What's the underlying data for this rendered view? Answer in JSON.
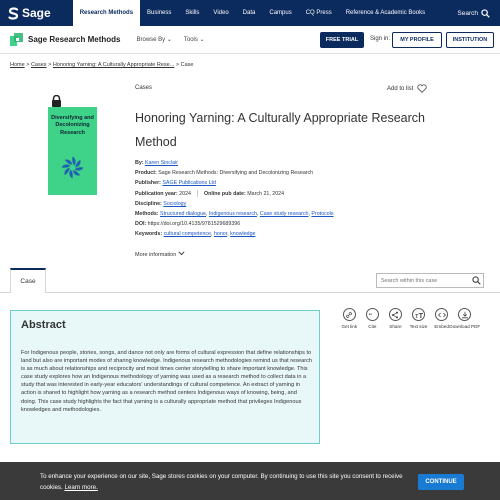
{
  "topbar": {
    "brand": "Sage",
    "nav": [
      "Research Methods",
      "Business",
      "Skills",
      "Video",
      "Data",
      "Campus",
      "CQ Press",
      "Reference & Academic Books"
    ],
    "active_nav": "Research Methods",
    "search_label": "Search",
    "bg_color": "#0b2a5e"
  },
  "secbar": {
    "product_name": "Sage Research Methods",
    "browse_label": "Browse By",
    "tools_label": "Tools",
    "free_trial": "FREE TRIAL",
    "sign_in": "Sign in:",
    "my_profile": "MY PROFILE",
    "institution": "INSTITUTION"
  },
  "breadcrumb": {
    "home": "Home",
    "cases": "Cases",
    "current_link": "Honoring Yarning: A Culturally Appropriate Rese...",
    "tail": "Case",
    "sep": " > "
  },
  "cover": {
    "title": "Diversifying and Decolonizing Research",
    "bg_color": "#3fd38a"
  },
  "doc": {
    "section": "Cases",
    "add_to_list": "Add to list",
    "title": "Honoring Yarning: A Culturally Appropriate Research Method"
  },
  "meta": {
    "by_label": "By:",
    "by": "Karen Sinclair",
    "product_label": "Product:",
    "product": "Sage Research Methods: Diversifying and Decolonizing Research",
    "publisher_label": "Publisher:",
    "publisher": "SAGE Publications Ltd",
    "pubyear_label": "Publication year:",
    "pubyear": "2024",
    "online_label": "Online pub date:",
    "online": "March 21, 2024",
    "discipline_label": "Discipline:",
    "discipline": "Sociology",
    "methods_label": "Methods:",
    "methods": [
      "Structured dialogue",
      "Indigenous research",
      "Case study research",
      "Protocols"
    ],
    "doi_label": "DOI:",
    "doi": "https://doi.org/10.4135/9781529689396",
    "keywords_label": "Keywords:",
    "keywords": [
      "cultural competence",
      "honor",
      "knowledge"
    ],
    "more_info": "More information"
  },
  "tabs": {
    "case": "Case",
    "search_placeholder": "Search within this case"
  },
  "tools": [
    {
      "label": "Get link",
      "icon": "link-icon"
    },
    {
      "label": "Cite",
      "icon": "quote-icon"
    },
    {
      "label": "Share",
      "icon": "share-icon"
    },
    {
      "label": "Text size",
      "icon": "text-size-icon"
    },
    {
      "label": "Embed",
      "icon": "embed-icon"
    },
    {
      "label": "Download PDF",
      "icon": "download-icon"
    }
  ],
  "abstract": {
    "heading": "Abstract",
    "text": "For Indigenous people, stories, songs, and dance not only are forms of cultural expression that define relationships to land but also are important modes of sharing knowledge. Indigenous research methodologies remind us that research is as much about relationships and reciprocity and most times center storytelling to share important knowledge. This case study explores how an Indigenous methodology of yarning was used as a research method to collect data in a study that was interested in early-year educators' understandings of cultural competence. An extract of yarning in action is shared to highlight how yarning as a research method centers Indigenous ways of knowing, being, and doing. This case study highlights the fact that yarning is a culturally appropriate method that privileges Indigenous knowledges and methodologies.",
    "bg_color": "#e8f8f8",
    "border_color": "#6ccfcf"
  },
  "cookie": {
    "message": "To enhance your experience on our site, Sage stores cookies on your computer. By continuing to use this site you consent to receive cookies.",
    "learn_more": "Learn more.",
    "button": "CONTINUE"
  }
}
